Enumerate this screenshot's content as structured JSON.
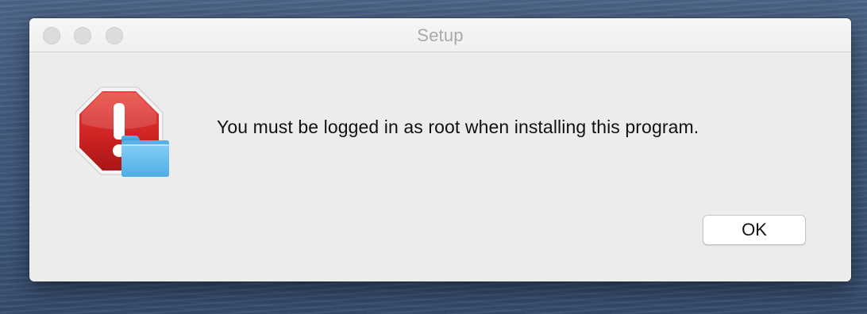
{
  "window": {
    "title": "Setup"
  },
  "alert": {
    "icon": "stop-sign-folder-icon",
    "message": "You must be logged in as root when installing this program."
  },
  "buttons": {
    "ok_label": "OK"
  },
  "colors": {
    "stop_red": "#d32a2a",
    "folder_blue": "#5fb6ea",
    "dialog_background": "#ececec"
  }
}
